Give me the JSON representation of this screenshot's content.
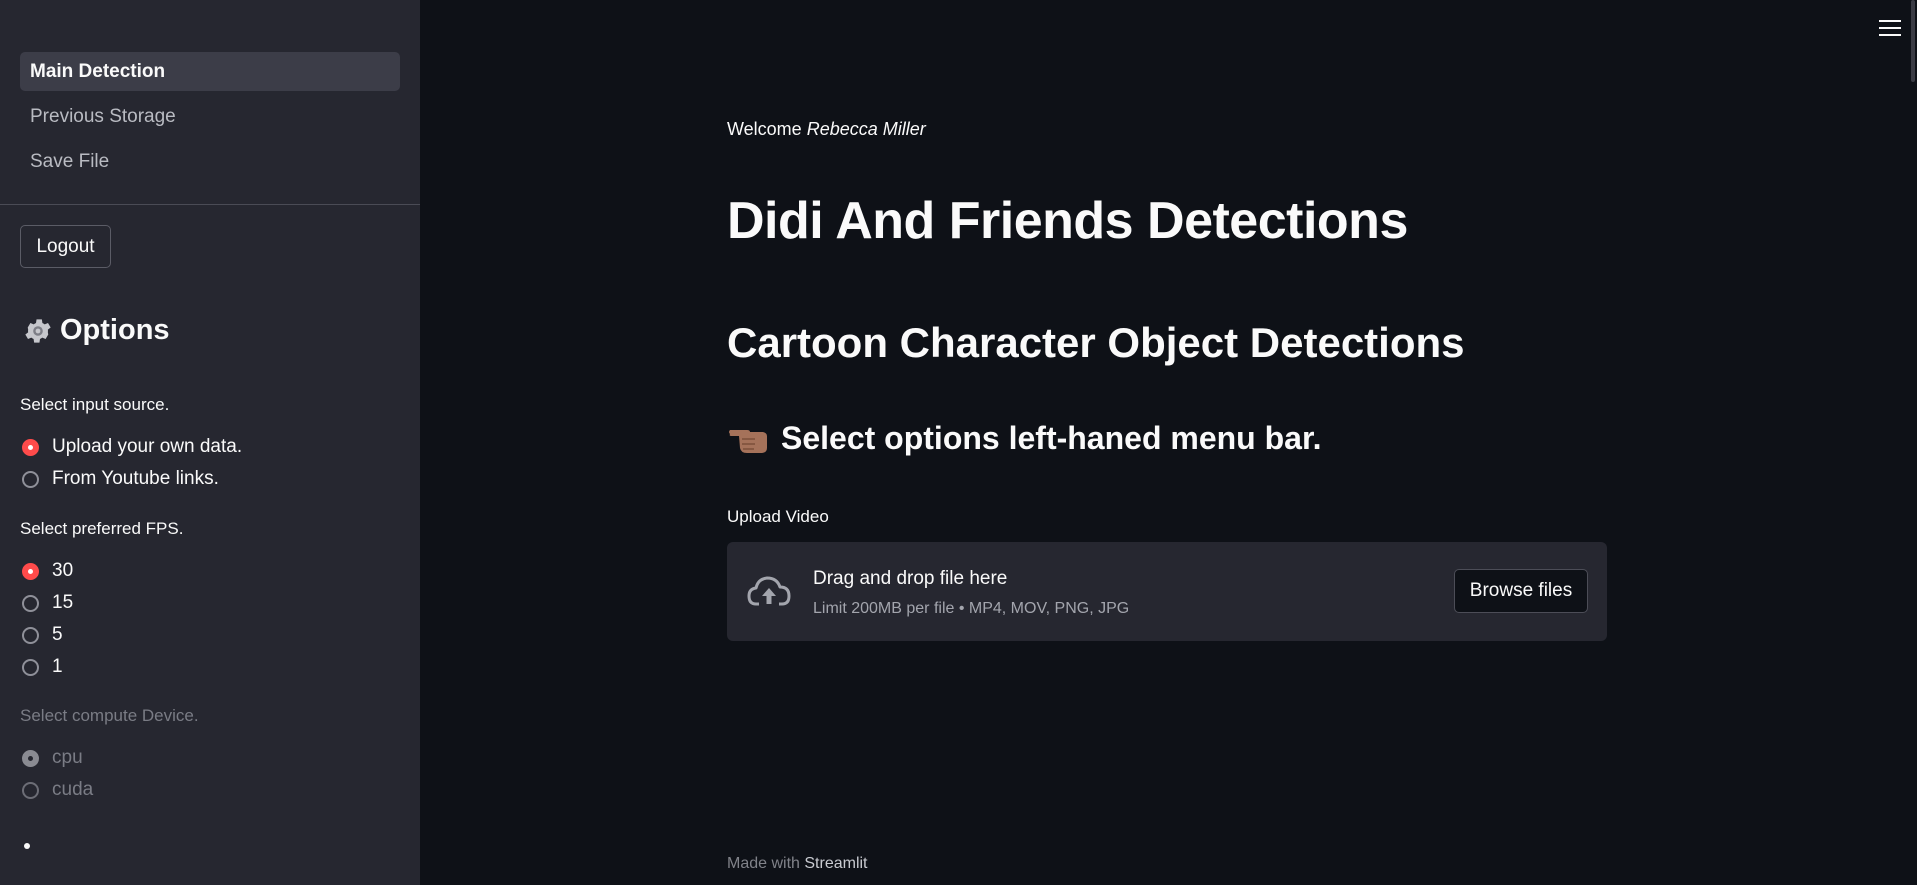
{
  "sidebar": {
    "nav_items": [
      {
        "label": "Main Detection",
        "active": true
      },
      {
        "label": "Previous Storage",
        "active": false
      },
      {
        "label": "Save File",
        "active": false
      }
    ],
    "logout_label": "Logout",
    "options_title": "Options",
    "options_icon": "gear-icon",
    "input_source": {
      "label": "Select input source.",
      "options": [
        "Upload your own data.",
        "From Youtube links."
      ],
      "selected": "Upload your own data."
    },
    "fps": {
      "label": "Select preferred FPS.",
      "options": [
        "30",
        "15",
        "5",
        "1"
      ],
      "selected": "30"
    },
    "device": {
      "label": "Select compute Device.",
      "options": [
        "cpu",
        "cuda"
      ],
      "selected": "cpu",
      "disabled": true
    }
  },
  "main": {
    "welcome_prefix": "Welcome",
    "welcome_name": "Rebecca Miller",
    "title": "Didi And Friends Detections",
    "subtitle": "Cartoon Character Object Detections",
    "instruction": "Select options left-haned menu bar.",
    "instruction_icon": "pointing-hand-icon",
    "upload": {
      "label": "Upload Video",
      "drop_title": "Drag and drop file here",
      "drop_limit": "Limit 200MB per file • MP4, MOV, PNG, JPG",
      "browse_label": "Browse files",
      "icon": "cloud-upload-icon"
    },
    "footer_prefix": "Made with",
    "footer_brand": "Streamlit",
    "menu_icon": "hamburger-menu-icon"
  },
  "colors": {
    "background": "#0e1117",
    "sidebar": "#262730",
    "accent": "#ff4b4b",
    "text": "#fafafa"
  }
}
